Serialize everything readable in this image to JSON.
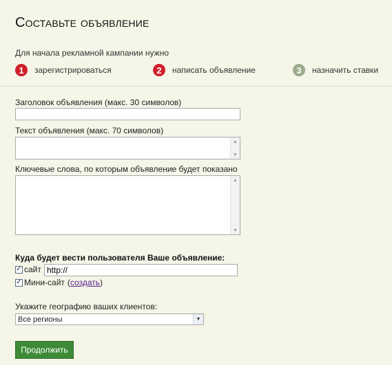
{
  "page": {
    "title": "Составьте объявление"
  },
  "intro": "Для начала рекламной кампании нужно",
  "steps": [
    {
      "num": "1",
      "label": "зарегистрироваться",
      "color": "#d0202a"
    },
    {
      "num": "2",
      "label": "написать объявление",
      "color": "#d0202a"
    },
    {
      "num": "3",
      "label": "назначить ставки",
      "color": "#9aaa8a"
    }
  ],
  "form": {
    "headline_label": "Заголовок объявления (макс. 30 символов)",
    "headline_value": "",
    "body_label": "Текст объявления (макс. 70 символов)",
    "body_value": "",
    "keywords_label": "Ключевые слова, по которым объявление будет показано",
    "keywords_value": "",
    "destination_label": "Куда будет вести пользователя Ваше объявление:",
    "site_option": {
      "label": "сайт",
      "checked": true,
      "url_value": "http://"
    },
    "minisite_option": {
      "label": "Мини-сайт",
      "checked": true,
      "paren_open": "(",
      "link": "создать",
      "paren_close": ")"
    },
    "geo_label": "Укажите географию ваших клиентов:",
    "geo_selected": "Все регионы",
    "continue_button": "Продолжить"
  }
}
